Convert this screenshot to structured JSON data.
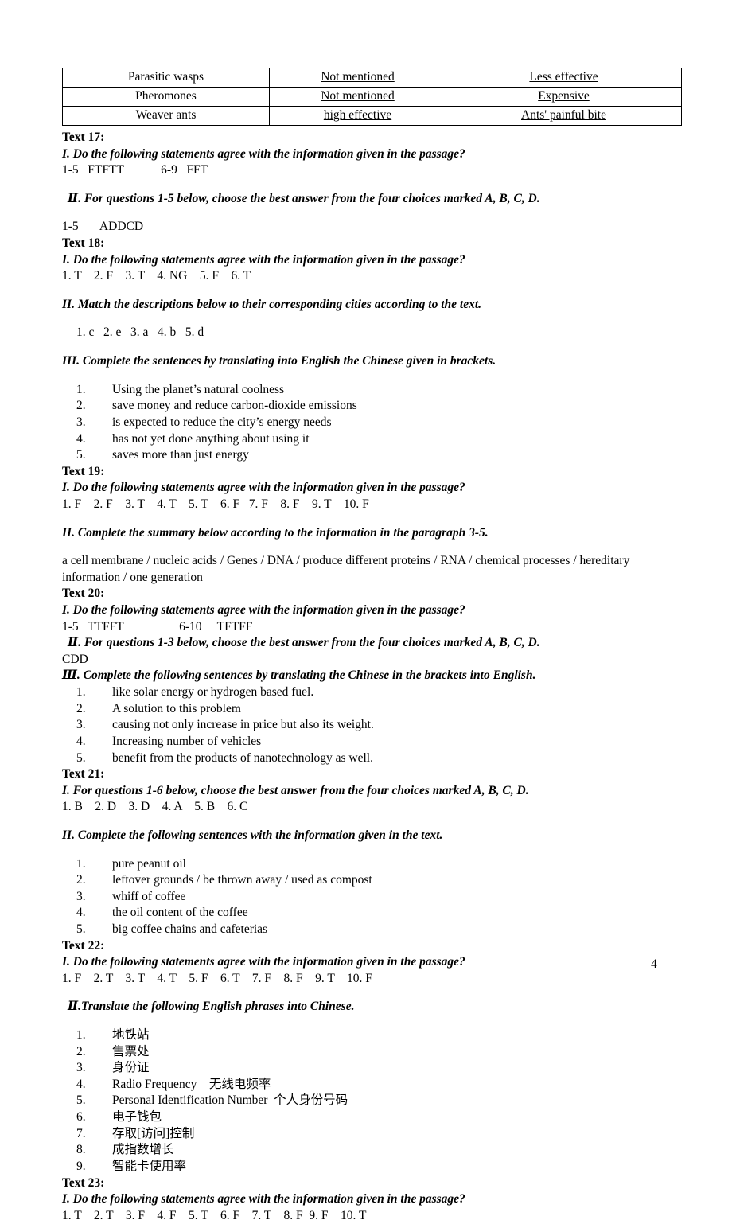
{
  "table": {
    "rows": [
      {
        "method": "Parasitic wasps",
        "effectiveness": "Not mentioned",
        "drawback": "Less effective"
      },
      {
        "method": "Pheromones",
        "effectiveness": "Not mentioned",
        "drawback": "Expensive"
      },
      {
        "method": "Weaver ants",
        "effectiveness": "high effective",
        "drawback": "Ants' painful bite"
      }
    ]
  },
  "sections": [
    {
      "heading": "Text 17:",
      "parts": [
        {
          "kind": "instruction",
          "text": "I. Do the following statements agree with the information given in the passage?"
        },
        {
          "kind": "answer",
          "text": "1-5   FTFTT            6-9   FFT"
        },
        {
          "kind": "gap"
        },
        {
          "kind": "instruction-indent",
          "text": "Ⅱ. For questions 1-5 below, choose the best answer from the four choices marked A, B, C, D."
        },
        {
          "kind": "gap"
        },
        {
          "kind": "answer",
          "text": "1-5       ADDCD"
        }
      ]
    },
    {
      "heading": "Text 18:",
      "parts": [
        {
          "kind": "instruction",
          "text": "I. Do the following statements agree with the information given in the passage?"
        },
        {
          "kind": "answer",
          "text": "1. T    2. F    3. T    4. NG    5. F    6. T"
        },
        {
          "kind": "gap"
        },
        {
          "kind": "instruction",
          "text": "II. Match the descriptions below to their corresponding cities according to the text."
        },
        {
          "kind": "gap"
        },
        {
          "kind": "answer-indent",
          "text": "1. c   2. e   3. a   4. b   5. d"
        },
        {
          "kind": "gap"
        },
        {
          "kind": "instruction",
          "text": "III. Complete the sentences by translating into English the Chinese given in brackets."
        },
        {
          "kind": "gap"
        },
        {
          "kind": "list",
          "items": [
            "Using the planet’s natural coolness",
            "save money and reduce carbon-dioxide emissions",
            "is expected to reduce the city’s energy needs",
            "has not yet done anything about using it",
            "saves more than just energy"
          ]
        }
      ]
    },
    {
      "heading": "Text 19:",
      "parts": [
        {
          "kind": "instruction",
          "text": "I. Do the following statements agree with the information given in the passage?"
        },
        {
          "kind": "answer",
          "text": "1. F    2. F    3. T    4. T    5. T    6. F   7. F    8. F    9. T    10. F"
        },
        {
          "kind": "gap"
        },
        {
          "kind": "instruction",
          "text": "II. Complete the summary below according to the information in the paragraph 3-5."
        },
        {
          "kind": "gap"
        },
        {
          "kind": "answer-wrap",
          "text": "a cell membrane / nucleic acids / Genes / DNA / produce different proteins / RNA / chemical processes / hereditary information / one generation"
        }
      ]
    },
    {
      "heading": "Text 20:",
      "parts": [
        {
          "kind": "instruction",
          "text": "I. Do the following statements agree with the information given in the passage?"
        },
        {
          "kind": "answer",
          "text": "1-5   TTFFT                  6-10     TFTFF"
        },
        {
          "kind": "instruction-indent",
          "text": "Ⅱ. For questions 1-3 below, choose the best answer from the four choices marked A, B, C, D."
        },
        {
          "kind": "answer",
          "text": "CDD"
        },
        {
          "kind": "instruction",
          "text": "Ⅲ. Complete the following sentences by translating the Chinese in the brackets into English."
        },
        {
          "kind": "list",
          "items": [
            "like solar energy or hydrogen based fuel.",
            "A solution to this problem",
            "causing not only increase in price but also its weight.",
            "Increasing number of vehicles",
            "benefit from the products of nanotechnology as well."
          ]
        }
      ]
    },
    {
      "heading": "Text 21:",
      "parts": [
        {
          "kind": "instruction",
          "text": "I. For questions 1-6 below, choose the best answer from the four choices marked A, B, C, D."
        },
        {
          "kind": "answer",
          "text": "1. B    2. D    3. D    4. A    5. B    6. C"
        },
        {
          "kind": "gap"
        },
        {
          "kind": "instruction",
          "text": "II. Complete the following sentences with the information given in the text."
        },
        {
          "kind": "gap"
        },
        {
          "kind": "list",
          "items": [
            "pure peanut oil",
            "leftover grounds / be thrown away / used as compost",
            "whiff of coffee",
            "the oil content of the coffee",
            "big coffee chains and cafeterias"
          ]
        }
      ]
    },
    {
      "heading": "Text 22:",
      "parts": [
        {
          "kind": "instruction",
          "text": "I. Do the following statements agree with the information given in the passage?"
        },
        {
          "kind": "answer",
          "text": "1. F    2. T    3. T    4. T    5. F    6. T    7. F    8. F    9. T    10. F"
        },
        {
          "kind": "gap"
        },
        {
          "kind": "instruction-indent",
          "text": "Ⅱ.Translate the following English phrases into Chinese."
        },
        {
          "kind": "gap"
        },
        {
          "kind": "list",
          "items": [
            "地铁站",
            "售票处",
            "身份证",
            "Radio Frequency    无线电频率",
            "Personal Identification Number  个人身份号码",
            "电子钱包",
            "存取[访问]控制",
            "成指数增长",
            "智能卡使用率"
          ]
        }
      ]
    },
    {
      "heading": "Text 23:",
      "parts": [
        {
          "kind": "instruction",
          "text": "I. Do the following statements agree with the information given in the passage?"
        },
        {
          "kind": "answer",
          "text": "1. T    2. T    3. F    4. F    5. T    6. F    7. T    8. F  9. F    10. T"
        }
      ]
    }
  ],
  "page_number": "4"
}
